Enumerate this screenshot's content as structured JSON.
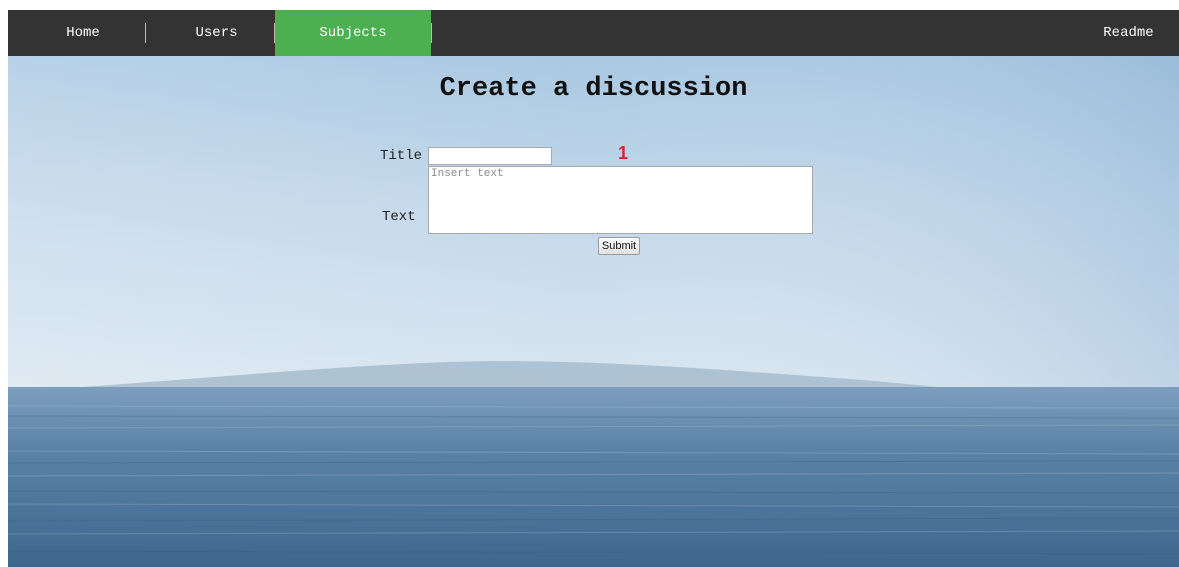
{
  "nav": {
    "items": [
      {
        "label": "Home"
      },
      {
        "label": "Users"
      },
      {
        "label": "Subjects",
        "active": true
      },
      {
        "label": "Readme"
      }
    ]
  },
  "page": {
    "title": "Create a discussion"
  },
  "form": {
    "title_label": "Title",
    "title_value": "",
    "text_label": "Text",
    "text_placeholder": "Insert text",
    "submit_label": "Submit"
  },
  "annotation": {
    "marker": "1"
  },
  "colors": {
    "nav_background": "#333333",
    "nav_active": "#4caf50",
    "annotation": "#e0202a"
  }
}
